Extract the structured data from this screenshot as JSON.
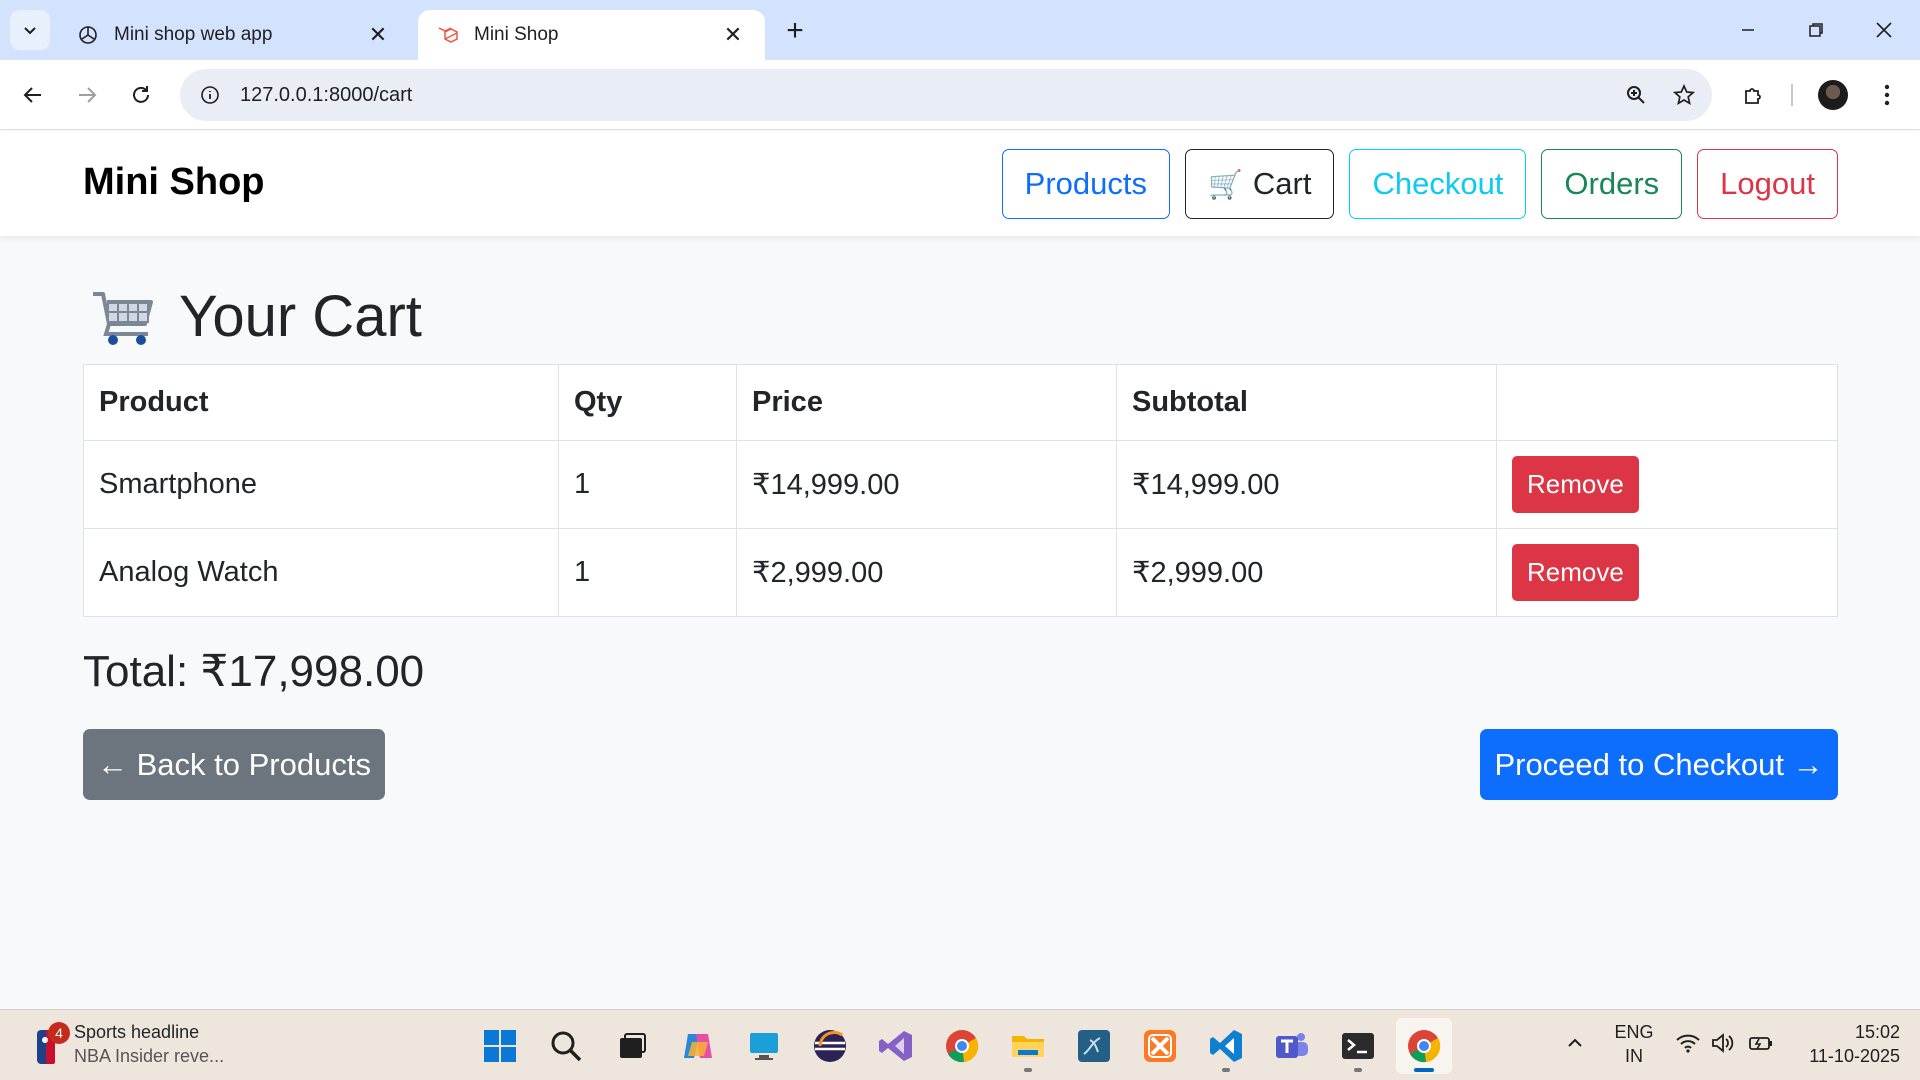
{
  "browser": {
    "tabs": [
      {
        "title": "Mini shop web app",
        "active": false,
        "icon": "chatgpt-icon"
      },
      {
        "title": "Mini Shop",
        "active": true,
        "icon": "laravel-icon"
      }
    ],
    "url": "127.0.0.1:8000/cart"
  },
  "navbar": {
    "brand": "Mini Shop",
    "links": {
      "products": "Products",
      "cart": "Cart",
      "checkout": "Checkout",
      "orders": "Orders",
      "logout": "Logout"
    },
    "cart_emoji": "🛒"
  },
  "cart": {
    "heading": "Your Cart",
    "columns": [
      "Product",
      "Qty",
      "Price",
      "Subtotal",
      ""
    ],
    "rows": [
      {
        "product": "Smartphone",
        "qty": "1",
        "price": "₹14,999.00",
        "subtotal": "₹14,999.00",
        "action": "Remove"
      },
      {
        "product": "Analog Watch",
        "qty": "1",
        "price": "₹2,999.00",
        "subtotal": "₹2,999.00",
        "action": "Remove"
      }
    ],
    "total": "Total: ₹17,998.00",
    "back_label": "← Back to Products",
    "checkout_label": "Proceed to Checkout →"
  },
  "taskbar": {
    "widget": {
      "title": "Sports headline",
      "subtitle": "NBA Insider reve...",
      "badge": "4"
    },
    "apps": [
      "windows-start",
      "search",
      "task-view",
      "copilot",
      "remote-desktop",
      "eclipse",
      "visual-studio",
      "chrome",
      "file-explorer",
      "mysql-workbench",
      "xampp",
      "vscode",
      "teams",
      "terminal",
      "chrome-active"
    ],
    "tray": {
      "lang_line1": "ENG",
      "lang_line2": "IN",
      "time": "15:02",
      "date": "11-10-2025"
    }
  },
  "colors": {
    "primary": "#0d6efd",
    "info": "#0dcaf0",
    "success": "#198754",
    "danger": "#dc3545",
    "secondary": "#6c757d",
    "dark": "#212529"
  }
}
